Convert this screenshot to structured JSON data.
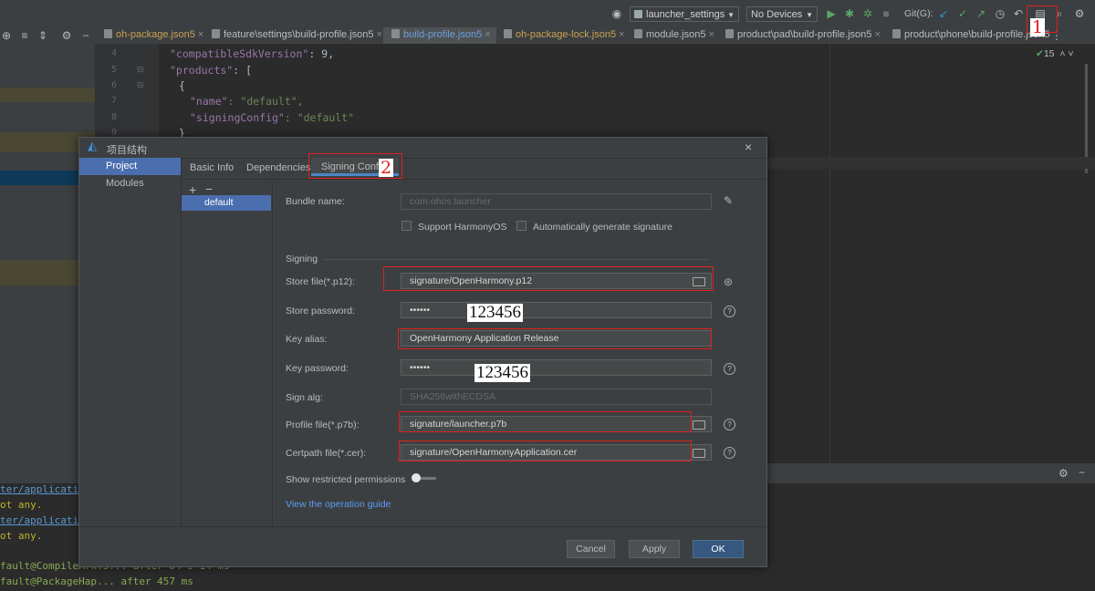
{
  "toolbar": {
    "config_select": "launcher_settings",
    "device_select": "No Devices",
    "git_label": "Git(G):"
  },
  "tabs": [
    {
      "label": "oh-package.json5"
    },
    {
      "label": "feature\\settings\\build-profile.json5"
    },
    {
      "label": "build-profile.json5"
    },
    {
      "label": "oh-package-lock.json5"
    },
    {
      "label": "module.json5"
    },
    {
      "label": "product\\pad\\build-profile.json5"
    },
    {
      "label": "product\\phone\\build-profile.json5"
    }
  ],
  "editor": {
    "line_numbers": [
      "4",
      "5",
      "6",
      "7",
      "8",
      "9"
    ],
    "lines": [
      {
        "key": "\"compatibleSdkVersion\"",
        "rest": ": 9,"
      },
      {
        "key": "\"products\"",
        "rest": ": ["
      },
      {
        "key": "",
        "rest": "{"
      },
      {
        "key": "\"name\"",
        "rest": ": \"default\","
      },
      {
        "key": "\"signingConfig\"",
        "rest": ": \"default\""
      },
      {
        "key": "",
        "rest": "}"
      }
    ],
    "inspection_count": "15"
  },
  "console": {
    "lines": [
      "ter/application",
      "ot any.",
      "ter/application",
      "ot any.",
      "fault@CompileArkTS... after 64 s 14 ms",
      "fault@PackageHap... after 457 ms"
    ]
  },
  "dialog": {
    "title": "项目结构",
    "nav": [
      {
        "label": "Project"
      },
      {
        "label": "Modules"
      }
    ],
    "tabs": [
      {
        "label": "Basic Info"
      },
      {
        "label": "Dependencies"
      },
      {
        "label": "Signing Configs"
      }
    ],
    "configs": [
      {
        "label": "default"
      }
    ],
    "form": {
      "bundle_name_label": "Bundle name:",
      "bundle_name_value": "com.ohos.launcher",
      "support_harmonyos_label": "Support HarmonyOS",
      "auto_generate_label": "Automatically generate signature",
      "signing_section": "Signing",
      "store_file_label": "Store file(*.p12):",
      "store_file_value": "signature/OpenHarmony.p12",
      "store_password_label": "Store password:",
      "store_password_value": "••••••",
      "key_alias_label": "Key alias:",
      "key_alias_value": "OpenHarmony Application Release",
      "key_password_label": "Key password:",
      "key_password_value": "••••••",
      "sign_alg_label": "Sign alg:",
      "sign_alg_value": "SHA256withECDSA",
      "profile_file_label": "Profile file(*.p7b):",
      "profile_file_value": "signature/launcher.p7b",
      "certpath_file_label": "Certpath file(*.cer):",
      "certpath_file_value": "signature/OpenHarmonyApplication.cer",
      "restricted_label": "Show restricted permissions",
      "guide_link": "View the operation guide"
    },
    "buttons": {
      "cancel": "Cancel",
      "apply": "Apply",
      "ok": "OK"
    }
  },
  "annotations": {
    "step1": "1",
    "step2": "2",
    "store_password_hint": "123456",
    "key_password_hint": "123456"
  },
  "colors": {
    "accent": "#4b6eaf",
    "annotation_red": "#e02020",
    "ok_button": "#365880"
  }
}
